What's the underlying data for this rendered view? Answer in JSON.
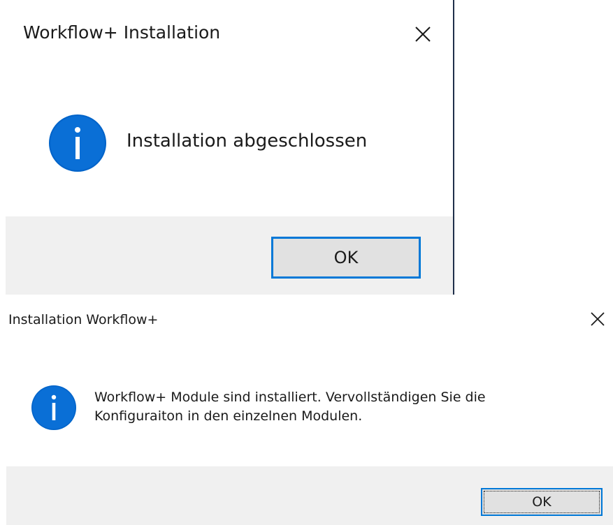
{
  "dialog1": {
    "title": "Workflow+ Installation",
    "icon": "info-icon",
    "message": "Installation abgeschlossen",
    "ok_label": "OK"
  },
  "dialog2": {
    "title": "Installation Workflow+",
    "icon": "info-icon",
    "message_line1": "Workflow+ Module sind installiert. Vervollständigen Sie die",
    "message_line2": "Konfiguraiton in den einzelnen Modulen.",
    "ok_label": "OK"
  },
  "colors": {
    "accent": "#0078d7",
    "footer": "#f0f0f0",
    "button_face": "#e1e1e1",
    "text": "#1a1a1a"
  }
}
